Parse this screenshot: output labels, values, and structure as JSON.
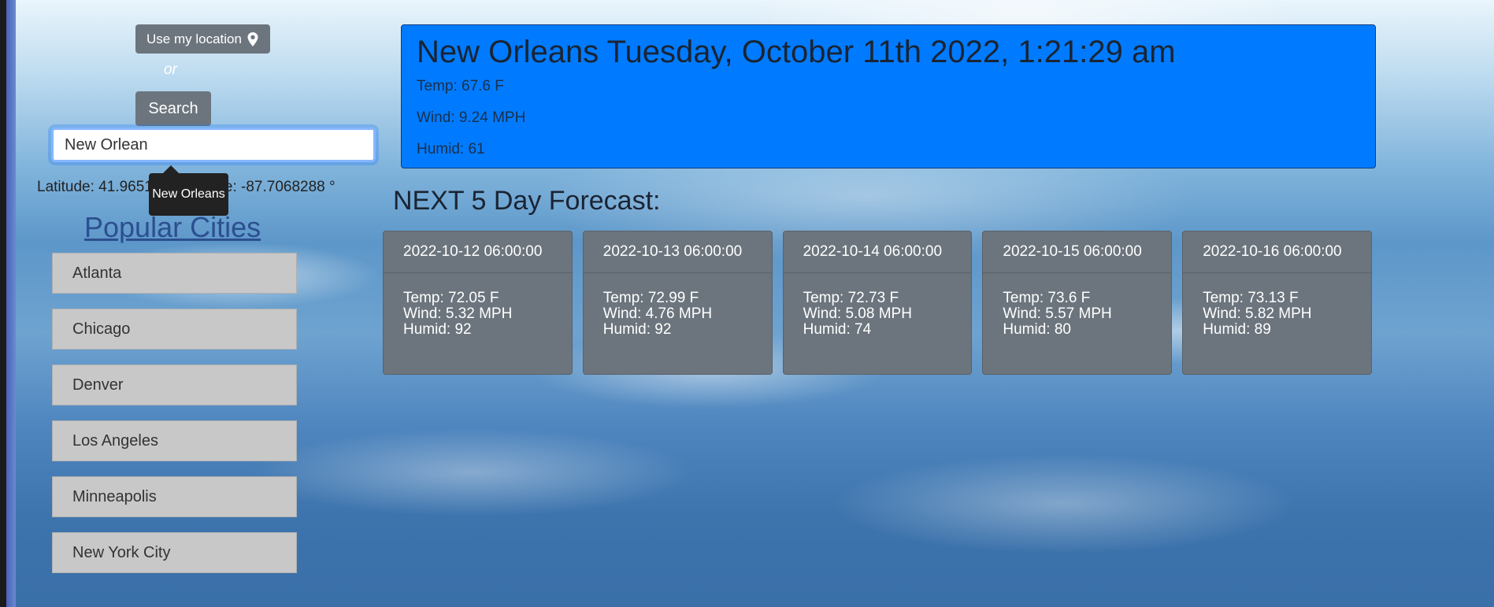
{
  "left_panel": {
    "location_button_label": "Use my location",
    "or_label": "or",
    "search_button_label": "Search",
    "search_value": "New Orlean",
    "coordinates_text": "Latitude: 41.9651 ° Longitude: -87.7068288 °",
    "autocomplete_suggestion": "New Orleans",
    "popular_title": "Popular Cities",
    "cities": [
      "Atlanta",
      "Chicago",
      "Denver",
      "Los Angeles",
      "Minneapolis",
      "New York City"
    ]
  },
  "current": {
    "title": "New Orleans Tuesday, October 11th 2022, 1:21:29 am",
    "temp": "Temp: 67.6 F",
    "wind": "Wind: 9.24 MPH",
    "humid": "Humid: 61"
  },
  "forecast": {
    "title": "NEXT 5 Day Forecast:",
    "days": [
      {
        "date": "2022-10-12 06:00:00",
        "temp": "Temp: 72.05 F",
        "wind": "Wind: 5.32 MPH",
        "humid": "Humid: 92"
      },
      {
        "date": "2022-10-13 06:00:00",
        "temp": "Temp: 72.99 F",
        "wind": "Wind: 4.76 MPH",
        "humid": "Humid: 92"
      },
      {
        "date": "2022-10-14 06:00:00",
        "temp": "Temp: 72.73 F",
        "wind": "Wind: 5.08 MPH",
        "humid": "Humid: 74"
      },
      {
        "date": "2022-10-15 06:00:00",
        "temp": "Temp: 73.6 F",
        "wind": "Wind: 5.57 MPH",
        "humid": "Humid: 80"
      },
      {
        "date": "2022-10-16 06:00:00",
        "temp": "Temp: 73.13 F",
        "wind": "Wind: 5.82 MPH",
        "humid": "Humid: 89"
      }
    ]
  },
  "icons": {
    "location": "map-pin-icon"
  },
  "colors": {
    "current_card": "#007bff",
    "secondary_button": "#6c757d",
    "city_button": "#c8c8c8",
    "link": "#2c4f8f"
  }
}
